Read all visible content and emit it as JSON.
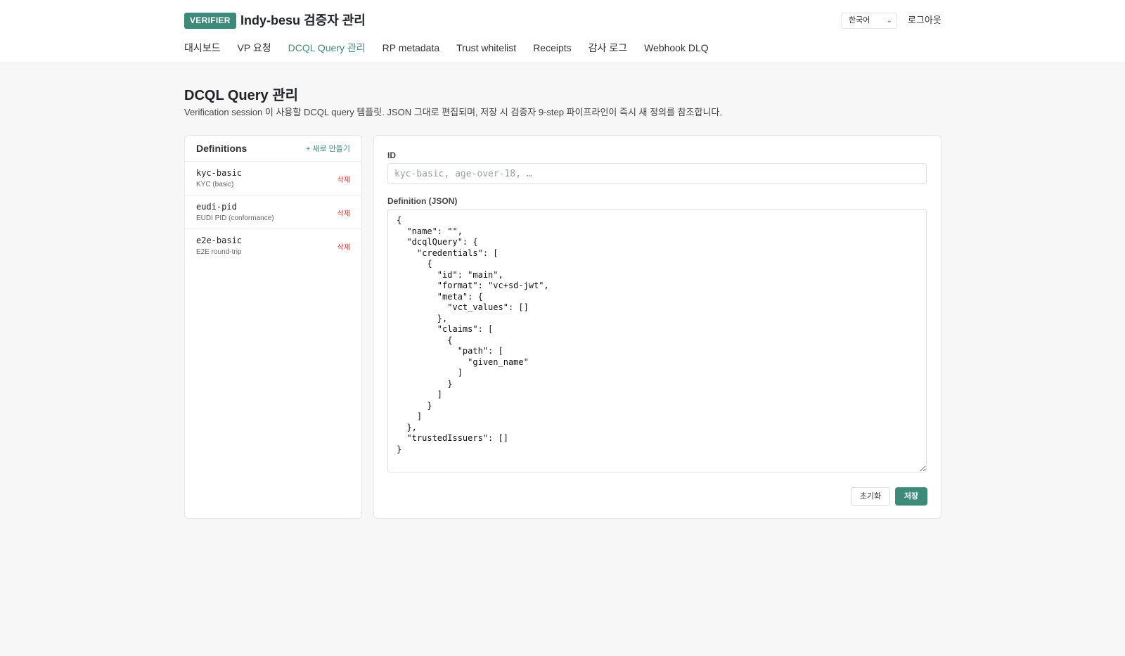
{
  "header": {
    "badge": "VERIFIER",
    "title": "Indy-besu 검증자 관리",
    "language": "한국어",
    "logout": "로그아웃"
  },
  "nav": {
    "tabs": [
      {
        "label": "대시보드",
        "active": false
      },
      {
        "label": "VP 요청",
        "active": false
      },
      {
        "label": "DCQL Query 관리",
        "active": true
      },
      {
        "label": "RP metadata",
        "active": false
      },
      {
        "label": "Trust whitelist",
        "active": false
      },
      {
        "label": "Receipts",
        "active": false
      },
      {
        "label": "감사 로그",
        "active": false
      },
      {
        "label": "Webhook DLQ",
        "active": false
      }
    ]
  },
  "page": {
    "heading": "DCQL Query 관리",
    "description": "Verification session 이 사용할 DCQL query 템플릿. JSON 그대로 편집되며, 저장 시 검증자 9-step 파이프라인이 즉시 새 정의를 참조합니다."
  },
  "definitions": {
    "title": "Definitions",
    "new_label": "+ 새로 만들기",
    "items": [
      {
        "id": "kyc-basic",
        "name": "KYC (basic)",
        "delete": "삭제"
      },
      {
        "id": "eudi-pid",
        "name": "EUDI PID (conformance)",
        "delete": "삭제"
      },
      {
        "id": "e2e-basic",
        "name": "E2E round-trip",
        "delete": "삭제"
      }
    ]
  },
  "editor": {
    "id_label": "ID",
    "id_value": "",
    "id_placeholder": "kyc-basic, age-over-18, …",
    "definition_label": "Definition (JSON)",
    "definition_text": "{\n  \"name\": \"\",\n  \"dcqlQuery\": {\n    \"credentials\": [\n      {\n        \"id\": \"main\",\n        \"format\": \"vc+sd-jwt\",\n        \"meta\": {\n          \"vct_values\": []\n        },\n        \"claims\": [\n          {\n            \"path\": [\n              \"given_name\"\n            ]\n          }\n        ]\n      }\n    ]\n  },\n  \"trustedIssuers\": []\n}",
    "reset_label": "초기화",
    "save_label": "저장"
  },
  "colors": {
    "accent": "#3d8a7a",
    "danger": "#d23b3b",
    "background": "#f7f7f8"
  }
}
